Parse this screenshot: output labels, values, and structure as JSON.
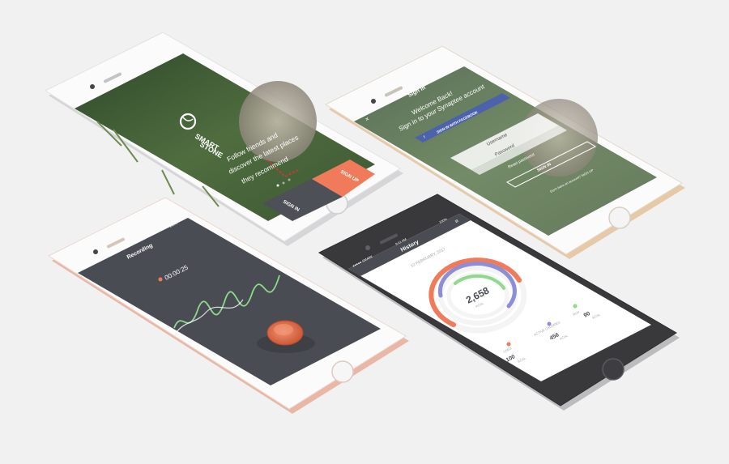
{
  "status": {
    "carrier": "●●●●● SMARK",
    "time": "9:41 AM",
    "battery": "100%"
  },
  "colors": {
    "accent": "#f07b5a",
    "dark": "#4a4c53",
    "green": "#8ed98c",
    "purple": "#8d8fd6"
  },
  "onboarding": {
    "logo_line1": "SMART",
    "logo_line2": "STONE",
    "tagline": [
      "Follow friends and",
      "discover the latest places",
      "they recommend"
    ],
    "sign_in_label": "SIGN IN",
    "sign_up_label": "SIGN UP"
  },
  "sign_in": {
    "title": "Sign In",
    "welcome_line1": "Welcome Back!",
    "welcome_line2": "Sign in to your Synaptee account",
    "facebook_label": "SIGN IN WITH FACEBOOK",
    "username_placeholder": "Username",
    "password_placeholder": "Password",
    "reset_label": "Reset password",
    "submit_label": "SIGN IN",
    "footer_text": "Don't have an account? SIGN UP"
  },
  "recording": {
    "title": "Recording",
    "timer": "00:00:25"
  },
  "history": {
    "title": "History",
    "date": "12 FEBRUARY, 2017",
    "total_value": "2,658",
    "total_unit": "KCAL",
    "stats": [
      {
        "label": "USED",
        "value": "100",
        "unit": "KCAL",
        "color": "#f07b5a"
      },
      {
        "label": "ACTIVE CALORIES",
        "value": "456",
        "unit": "KCAL",
        "color": "#8d8fd6"
      },
      {
        "label": "RUN",
        "value": "90",
        "unit": "KCAL",
        "color": "#8ed98c"
      }
    ]
  }
}
